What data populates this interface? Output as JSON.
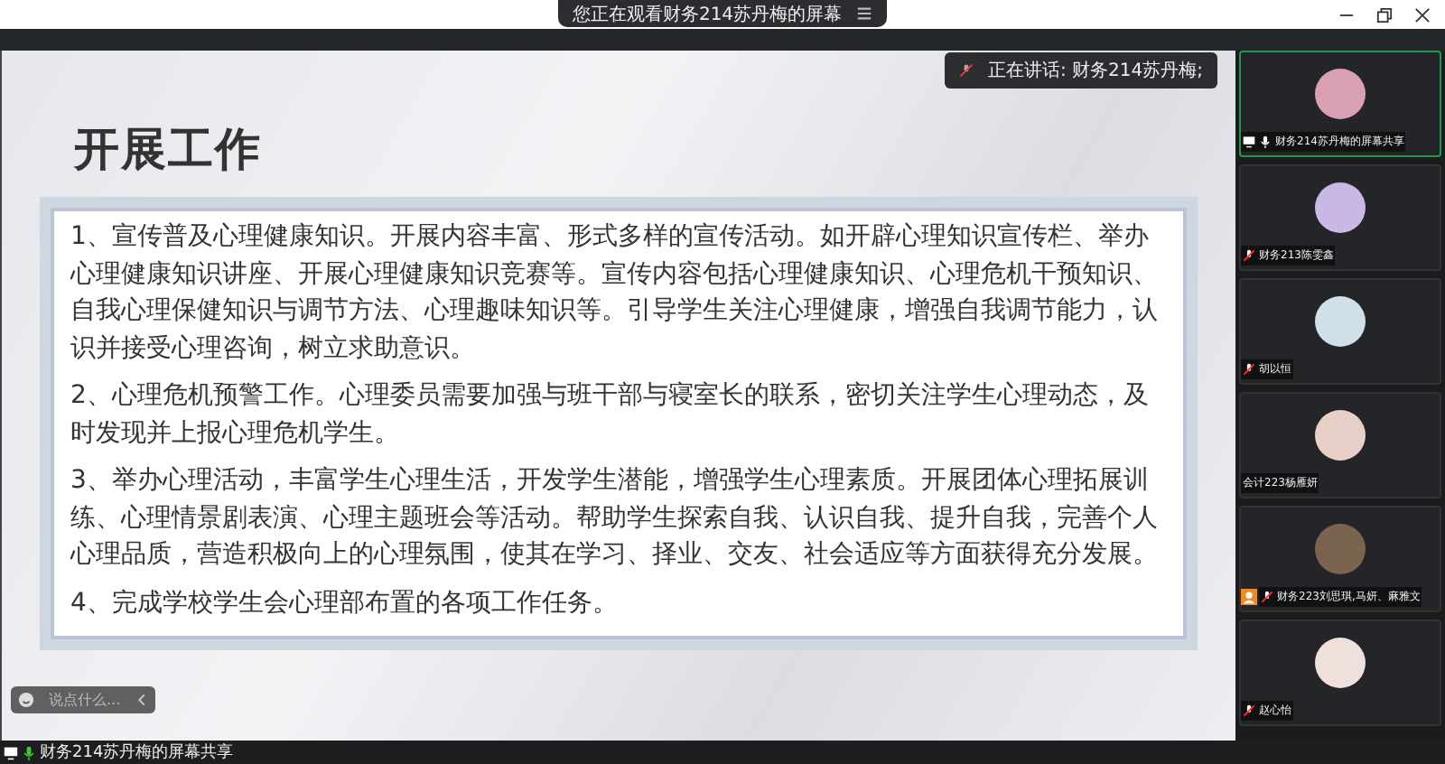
{
  "top_banner": {
    "text": "您正在观看财务214苏丹梅的屏幕"
  },
  "speaker_indicator": {
    "text": "正在讲话: 财务214苏丹梅;"
  },
  "slide": {
    "title": "开展工作",
    "paragraphs": [
      "1、宣传普及心理健康知识。开展内容丰富、形式多样的宣传活动。如开辟心理知识宣传栏、举办心理健康知识讲座、开展心理健康知识竞赛等。宣传内容包括心理健康知识、心理危机干预知识、自我心理保健知识与调节方法、心理趣味知识等。引导学生关注心理健康，增强自我调节能力，认识并接受心理咨询，树立求助意识。",
      "2、心理危机预警工作。心理委员需要加强与班干部与寝室长的联系，密切关注学生心理动态，及时发现并上报心理危机学生。",
      "3、举办心理活动，丰富学生心理生活，开发学生潜能，增强学生心理素质。开展团体心理拓展训练、心理情景剧表演、心理主题班会等活动。帮助学生探索自我、认识自我、提升自我，完善个人心理品质，营造积极向上的心理氛围，使其在学习、择业、交友、社会适应等方面获得充分发展。",
      "4、完成学校学生会心理部布置的各项工作任务。"
    ]
  },
  "chat_input": {
    "placeholder": "说点什么..."
  },
  "participants": [
    {
      "name": "财务214苏丹梅的屏幕共享",
      "speaking": true,
      "muted": false,
      "sharing": true
    },
    {
      "name": "财务213陈雯鑫",
      "speaking": false,
      "muted": true
    },
    {
      "name": "胡以恒",
      "speaking": false,
      "muted": true
    },
    {
      "name": "会计223杨雁妍",
      "speaking": false
    },
    {
      "name": "财务223刘思琪,马妍、麻雅文",
      "speaking": false,
      "muted": true,
      "host_badge": true
    },
    {
      "name": "赵心怡",
      "speaking": false,
      "muted": true
    }
  ],
  "share_label": {
    "text": "财务214苏丹梅的屏幕共享"
  }
}
